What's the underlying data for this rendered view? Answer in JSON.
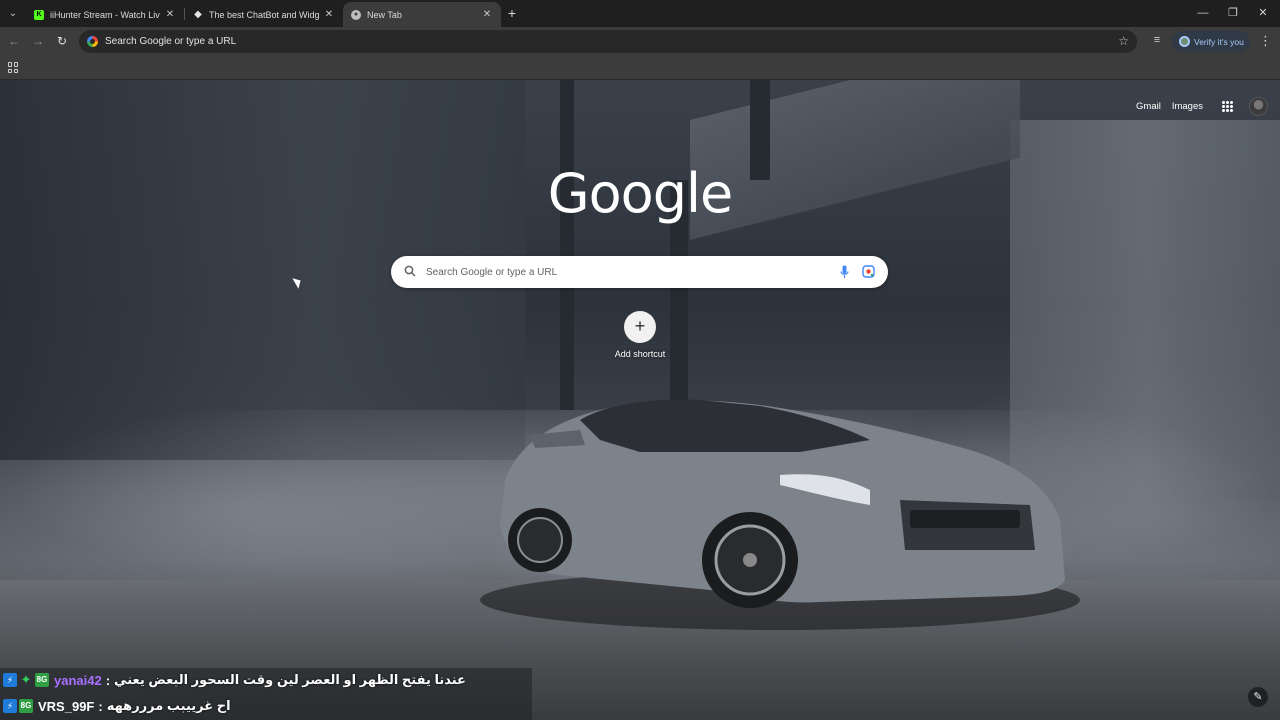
{
  "colors": {
    "accent": "#a8c7fa",
    "chrome_dark": "#1f1f1f",
    "toolbar": "#3c3c3c"
  },
  "tabs": [
    {
      "title": "iiHunter Stream - Watch Live on",
      "favicon": "kick-icon",
      "favicon_color": "#53fc18",
      "active": false
    },
    {
      "title": "The best ChatBot and Widgets",
      "favicon": "diamond-icon",
      "favicon_color": "#e6e6e6",
      "active": false
    },
    {
      "title": "New Tab",
      "favicon": "chrome-icon",
      "favicon_color": "#bdbdbd",
      "active": true
    }
  ],
  "tab_close_glyph": "✕",
  "new_tab_glyph": "+",
  "window_controls": {
    "minimize": "—",
    "restore": "❐",
    "close": "✕"
  },
  "toolbar": {
    "back": "←",
    "forward": "→",
    "reload": "↻",
    "omnibox_text": "Search Google or type a URL",
    "bookmark_star": "☆",
    "reading_mode": "≡",
    "verify_label": "Verify it's you",
    "menu": "⋮"
  },
  "ntp": {
    "links": {
      "gmail": "Gmail",
      "images": "Images"
    },
    "logo": "Google",
    "search_placeholder": "Search Google or type a URL",
    "add_shortcut_label": "Add shortcut",
    "add_shortcut_glyph": "+",
    "edit_glyph": "✎"
  },
  "chat": [
    {
      "user": "yanai42",
      "user_color": "#a970ff",
      "separator": ":",
      "message": "عندنا يفتح الظهر او العصر لين وقت السحور البعض يعني",
      "badges": [
        "⚡",
        "✦",
        "8G"
      ]
    },
    {
      "user": "VRS_99F",
      "user_color": "#ffffff",
      "separator": ":",
      "message": "اح غرييبب مرررههه",
      "badges": [
        "⚡",
        "8G"
      ]
    }
  ]
}
